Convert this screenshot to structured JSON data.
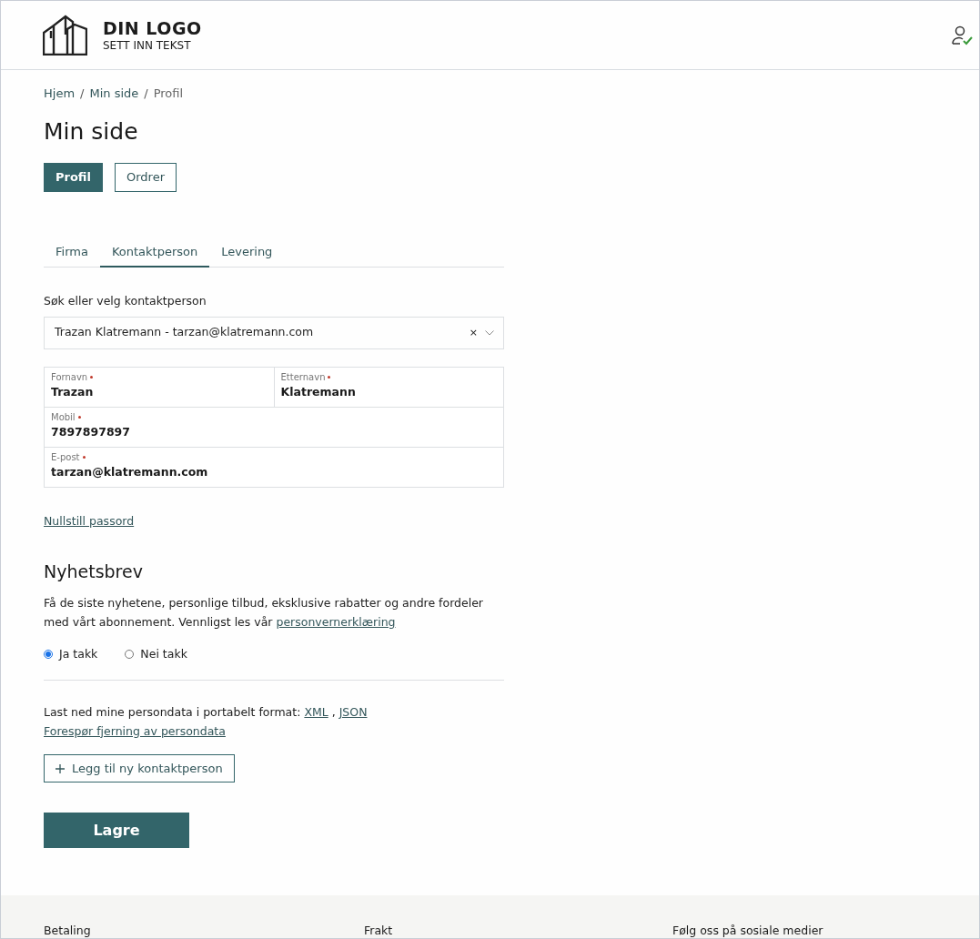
{
  "header": {
    "logo_title": "DIN LOGO",
    "logo_subtitle": "SETT INN TEKST"
  },
  "breadcrumb": [
    "Hjem",
    "Min side",
    "Profil"
  ],
  "breadcrumb_separator": "/",
  "page_title": "Min side",
  "section_buttons": [
    {
      "label": "Profil",
      "selected": true
    },
    {
      "label": "Ordrer",
      "selected": false
    }
  ],
  "tabs": [
    {
      "label": "Firma",
      "selected": false
    },
    {
      "label": "Kontaktperson",
      "selected": true
    },
    {
      "label": "Levering",
      "selected": false
    }
  ],
  "contact_select": {
    "label": "Søk eller velg kontaktperson",
    "value": "Trazan Klatremann - tarzan@klatremann.com",
    "clear": "×"
  },
  "fields": [
    {
      "label": "Fornavn",
      "required": true,
      "value": "Trazan"
    },
    {
      "label": "Etternavn",
      "required": true,
      "value": "Klatremann"
    },
    {
      "label": "Mobil",
      "required": true,
      "value": "7897897897"
    },
    {
      "label": "E-post",
      "required": true,
      "value": "tarzan@klatremann.com"
    }
  ],
  "reset_password_link": "Nullstill passord",
  "newsletter": {
    "title": "Nyhetsbrev",
    "text": "Få de siste nyhetene, personlige tilbud, eksklusive rabatter og andre fordeler med vårt abonnement. Vennligst les vår",
    "policy_link": "personvernerklæring",
    "options": [
      {
        "label": "Ja takk",
        "selected": true
      },
      {
        "label": "Nei takk",
        "selected": false
      }
    ]
  },
  "download": {
    "text": "Last ned mine persondata i portabelt format:",
    "links": [
      "XML",
      "JSON"
    ],
    "separator": ","
  },
  "removal_link": "Forespør fjerning av persondata",
  "add_contact_button": "Legg til ny kontaktperson",
  "save_button": "Lagre",
  "footer": {
    "columns": [
      "Betaling",
      "Frakt",
      "Følg oss på sosiale medier"
    ]
  }
}
